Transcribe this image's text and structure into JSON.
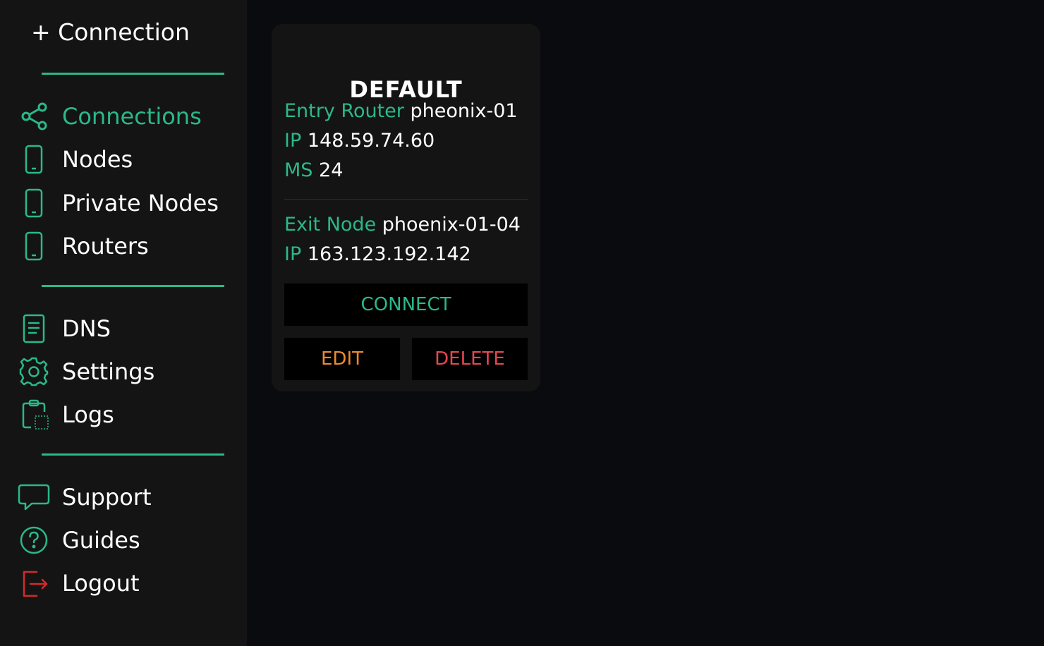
{
  "sidebar": {
    "new_connection": "+ Connection",
    "groups": [
      [
        {
          "label": "Connections",
          "icon": "share-icon",
          "active": true
        },
        {
          "label": "Nodes",
          "icon": "phone-icon"
        },
        {
          "label": "Private Nodes",
          "icon": "phone-icon"
        },
        {
          "label": "Routers",
          "icon": "phone-icon"
        }
      ],
      [
        {
          "label": "DNS",
          "icon": "document-icon"
        },
        {
          "label": "Settings",
          "icon": "gear-icon"
        },
        {
          "label": "Logs",
          "icon": "clipboard-icon"
        }
      ],
      [
        {
          "label": "Support",
          "icon": "chat-bubble-icon"
        },
        {
          "label": "Guides",
          "icon": "help-circle-icon"
        },
        {
          "label": "Logout",
          "icon": "logout-icon"
        }
      ]
    ]
  },
  "card": {
    "title": "DEFAULT",
    "entry": {
      "router_key": "Entry Router",
      "router_value": "pheonix-01",
      "ip_key": "IP",
      "ip_value": "148.59.74.60",
      "ms_key": "MS",
      "ms_value": "24"
    },
    "exit": {
      "node_key": "Exit Node",
      "node_value": "phoenix-01-04",
      "ip_key": "IP",
      "ip_value": "163.123.192.142"
    },
    "connect_label": "CONNECT",
    "edit_label": "EDIT",
    "delete_label": "DELETE"
  },
  "colors": {
    "accent": "#2bb88a",
    "edit": "#f08a2c",
    "delete": "#e8474f",
    "logout_icon": "#d42a2a",
    "sidebar_bg": "#141414",
    "page_bg": "#0a0b0f"
  }
}
